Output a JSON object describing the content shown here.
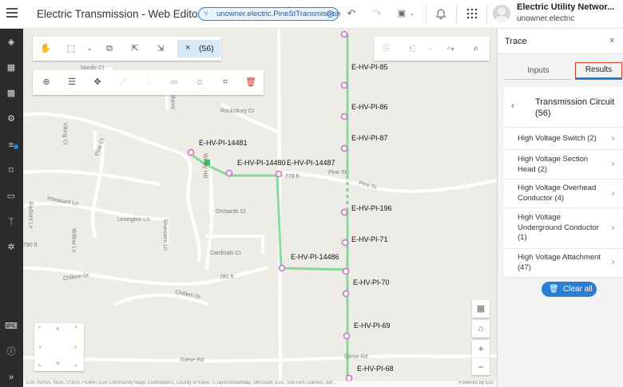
{
  "header": {
    "app_title": "Electric Transmission - Web Editor ...",
    "version_label": "unowner.electric.PineStTransmission",
    "user_name": "Electric Utility Networ...",
    "user_account": "unowner.electric",
    "icons": [
      "menu-icon",
      "version-icon",
      "undo-icon",
      "redo-icon",
      "save-icon",
      "notifications-icon",
      "apps-grid-icon",
      "user-avatar"
    ]
  },
  "sidebar": {
    "icons": [
      "layers-icon",
      "table-icon",
      "qr-icon",
      "trace-icon",
      "list-icon",
      "bookmark-icon",
      "folder-icon",
      "branch-icon",
      "settings-icon",
      "keyboard-icon",
      "info-icon",
      "expand-icon"
    ]
  },
  "toolbar": {
    "selection_count": "(56)",
    "clear_selection_icon": "close-icon"
  },
  "map": {
    "street_labels": [
      "Nordic Ct",
      "Viking Ct",
      "Pine Ct",
      "Rocksbury Ct",
      "Pine St",
      "Pine St",
      "Radiant Ln",
      "Pheasant Ln",
      "Lexington Ln",
      "Willow Ln",
      "Bluestem Ln",
      "Orchards Ct",
      "Cardinals Ct",
      "Chillem Dr",
      "Chillem Dr",
      "Giese Rd",
      "Giese Rd",
      "Windy Hill",
      "Manor"
    ],
    "elevation_labels": [
      "778 ft",
      "790 ft",
      "781 ft"
    ],
    "feature_labels": {
      "pi85": "E-HV-PI-85",
      "pi86": "E-HV-PI-86",
      "pi87": "E-HV-PI-87",
      "pi14481": "E-HV-PI-14481",
      "pi14480": "E-HV-PI-14480",
      "pi14487": "E-HV-PI-14487",
      "pi196": "E-HV-PI-196",
      "pi71": "E-HV-PI-71",
      "pi14486": "E-HV-PI-14486",
      "pi70": "E-HV-PI-70",
      "pi69": "E-HV-PI-69",
      "pi68": "E-HV-PI-68"
    },
    "attribution": "Esri, NASA, NGA, USGS, FEMA | Esri Community Maps Contributors, County of Kane, © OpenStreetMap, Microsoft, Esri, TomTom, Garmin, Saf...",
    "powered_by": "Powered by Esri",
    "zoom_in": "+",
    "zoom_out": "−"
  },
  "panel": {
    "title": "Trace",
    "close": "×",
    "tabs": {
      "inputs": "Inputs",
      "results": "Results"
    },
    "result_title": "Transmission Circuit (56)",
    "items": [
      {
        "label": "High Voltage Switch (2)"
      },
      {
        "label": "High Voltage Section Head (2)"
      },
      {
        "label": "High Voltage Overhead Conductor (4)"
      },
      {
        "label": "High Voltage Underground Conductor (1)"
      },
      {
        "label": "High Voltage Attachment (47)"
      }
    ],
    "clear_all": "Clear all"
  },
  "colors": {
    "accent": "#2a7fd4",
    "trace_green": "#5fcf7a",
    "point_pink": "#c66fc6",
    "results_outline": "#d93a2a"
  }
}
